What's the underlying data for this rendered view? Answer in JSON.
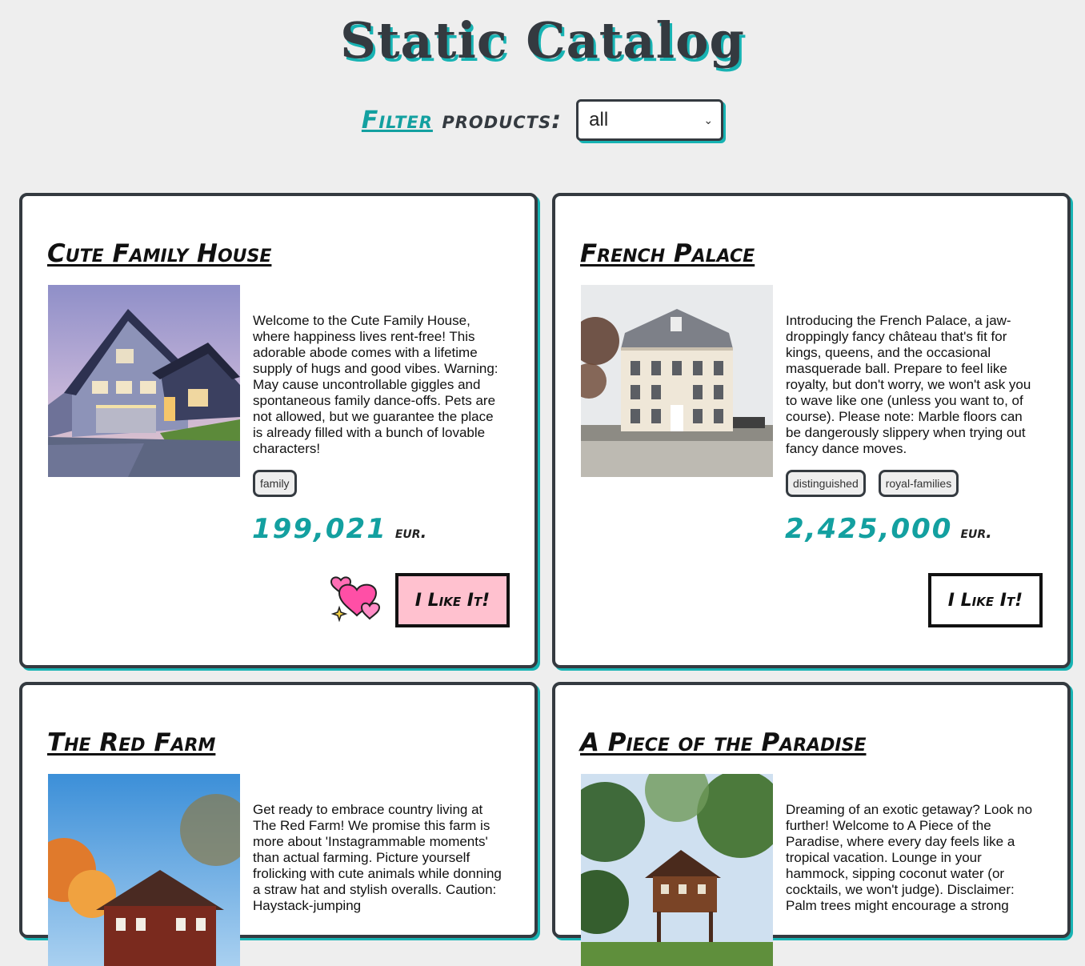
{
  "header": {
    "title": "Static Catalog",
    "filter_link": "Filter",
    "filter_text": "products:",
    "filter_selected": "all"
  },
  "products": [
    {
      "title": "Cute Family House",
      "image": "house-photo",
      "description": "Welcome to the Cute Family House, where happiness lives rent-free! This adorable abode comes with a lifetime supply of hugs and good vibes. Warning: May cause uncontrollable giggles and spontaneous family dance-offs. Pets are not allowed, but we guarantee the place is already filled with a bunch of lovable characters!",
      "tags": [
        "family"
      ],
      "price": "199,021",
      "currency": "eur.",
      "like_label": "I Like It!",
      "liked": true
    },
    {
      "title": "French Palace",
      "image": "chateau-photo",
      "description": "Introducing the French Palace, a jaw-droppingly fancy château that's fit for kings, queens, and the occasional masquerade ball. Prepare to feel like royalty, but don't worry, we won't ask you to wave like one (unless you want to, of course). Please note: Marble floors can be dangerously slippery when trying out fancy dance moves.",
      "tags": [
        "distinguished",
        "royal-families"
      ],
      "price": "2,425,000",
      "currency": "eur.",
      "like_label": "I Like It!",
      "liked": false
    },
    {
      "title": "The Red Farm",
      "image": "farm-photo",
      "description": "Get ready to embrace country living at The Red Farm! We promise this farm is more about 'Instagrammable moments' than actual farming. Picture yourself frolicking with cute animals while donning a straw hat and stylish overalls. Caution: Haystack-jumping"
    },
    {
      "title": "A Piece of the Paradise",
      "image": "tropical-house-photo",
      "description": "Dreaming of an exotic getaway? Look no further! Welcome to A Piece of the Paradise, where every day feels like a tropical vacation. Lounge in your hammock, sipping coconut water (or cocktails, we won't judge). Disclaimer: Palm trees might encourage a strong"
    }
  ],
  "colors": {
    "accent": "#13a0a0",
    "dark": "#343a40",
    "liked_bg": "#ffc1cf",
    "page_bg": "#eeeeee"
  }
}
